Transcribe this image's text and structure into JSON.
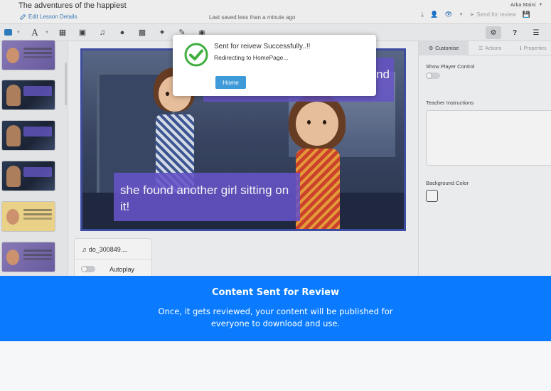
{
  "header": {
    "title": "The adventures of the happiest",
    "edit_label": "Edit Lesson Details",
    "saved_status": "Last saved less than a minute ago",
    "user_name": "Arka Maini",
    "send_label": "Send for review"
  },
  "toolbar": {
    "tools": [
      "shape-icon",
      "text-icon",
      "activity-icon",
      "image-icon",
      "audio-icon",
      "hotspot-icon",
      "texture-icon",
      "sticker-icon",
      "pen-icon",
      "record-icon"
    ],
    "help_label": "?"
  },
  "stage": {
    "bubble_text": "nd",
    "caption_text": "she found another girl sitting on it!"
  },
  "audio_card": {
    "file_name": "do_300849....",
    "toggle_label": "Autoplay",
    "autoplay_on": false
  },
  "right_panel": {
    "tabs": [
      {
        "label": "Customise",
        "icon": "gear-icon",
        "active": true
      },
      {
        "label": "Actions",
        "icon": "list-icon",
        "active": false
      },
      {
        "label": "Properties",
        "icon": "info-icon",
        "active": false
      }
    ],
    "show_player_control_label": "Show Player Control",
    "show_player_control_on": false,
    "teacher_instructions_label": "Teacher Instructions",
    "background_color_label": "Background Color",
    "background_color": "#ffffff"
  },
  "modal": {
    "title": "Sent for reivew Successfully..!!",
    "subtitle": "Redirecting to HomePage...",
    "button_label": "Home",
    "accent_color": "#3fae3f"
  },
  "banner": {
    "heading": "Content Sent for Review",
    "body": "Once, it gets reviewed, your content will be published for everyone to download and use.",
    "color": "#0a7bff"
  }
}
